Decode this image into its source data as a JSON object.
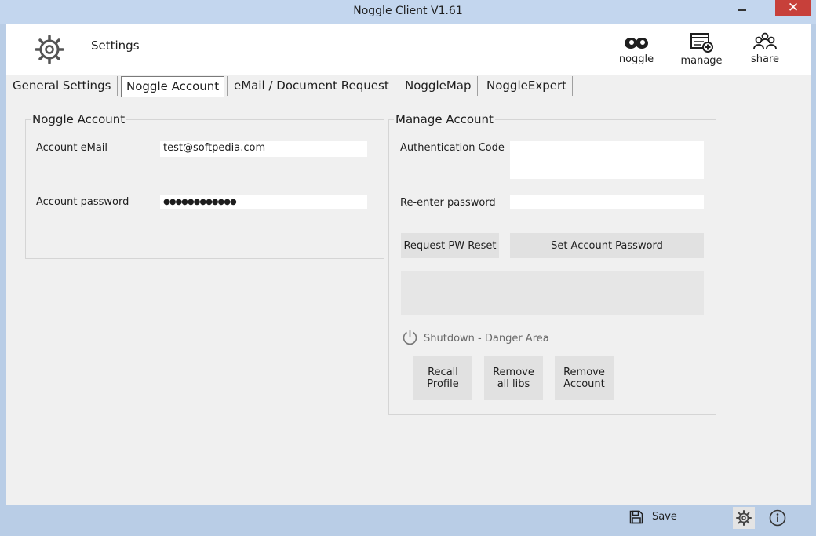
{
  "window": {
    "title": "Noggle Client V1.61",
    "close_glyph": "✕"
  },
  "header": {
    "title": "Settings",
    "icon": "gear-icon",
    "buttons": [
      {
        "label": "noggle",
        "icon": "eyes-icon"
      },
      {
        "label": "manage",
        "icon": "manage-icon"
      },
      {
        "label": "share",
        "icon": "people-icon"
      }
    ]
  },
  "tabs": [
    {
      "label": "General Settings",
      "active": false
    },
    {
      "label": "Noggle Account",
      "active": true
    },
    {
      "label": "eMail / Document Request",
      "active": false
    },
    {
      "label": "NoggleMap",
      "active": false
    },
    {
      "label": "NoggleExpert",
      "active": false
    }
  ],
  "noggle_account": {
    "title": "Noggle Account",
    "email_label": "Account eMail",
    "email_value": "test@softpedia.com",
    "password_label": "Account password",
    "password_value": "●●●●●●●●●●●●"
  },
  "manage_account": {
    "title": "Manage Account",
    "auth_code_label": "Authentication Code",
    "reenter_label": "Re-enter password",
    "request_reset_label": "Request PW Reset",
    "set_password_label": "Set Account Password",
    "danger_title": "Shutdown - Danger Area",
    "recall_profile": [
      "Recall",
      "Profile"
    ],
    "remove_libs": [
      "Remove",
      "all libs"
    ],
    "remove_account": [
      "Remove",
      "Account"
    ]
  },
  "footer": {
    "save_label": "Save"
  },
  "colors": {
    "titlebar": "#c3d6ee",
    "close": "#c7403a",
    "bottombar": "#b9cde6"
  }
}
